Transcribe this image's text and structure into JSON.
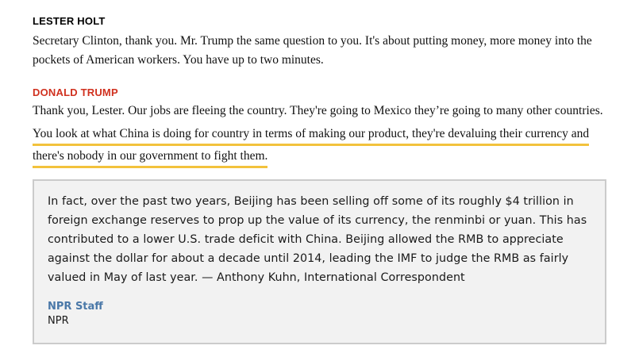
{
  "exchange": {
    "holt": {
      "speaker": "LESTER HOLT",
      "text": "Secretary Clinton, thank you. Mr. Trump the same question to you. It's about putting money, more money into the pockets of American workers. You have up to two minutes."
    },
    "trump": {
      "speaker": "DONALD TRUMP",
      "text_plain": "Thank you, Lester. Our jobs are fleeing the country. They're going to Mexico they’re going to many other countries.",
      "text_highlight_1": "You look at what China is doing for country in terms of making our product, they're devaluing their currency and",
      "text_highlight_2": "there's nobody in our government to fight them."
    }
  },
  "annotation": {
    "text": "In fact, over the past two years, Beijing has been selling off some of its roughly $4 trillion in foreign exchange reserves to prop up the value of its currency, the renminbi or yuan. This has contributed to a lower U.S. trade deficit with China. Beijing allowed the RMB to appreciate against the dollar for about a decade until 2014, leading the IMF to judge the RMB as fairly valued in May of last year. — Anthony Kuhn, International Correspondent",
    "author": "NPR Staff",
    "org": "NPR"
  },
  "colors": {
    "trump_name": "#d0311f",
    "highlight_underline": "#f2c23c",
    "author_link": "#4a78a8",
    "annotation_bg": "#f2f2f2",
    "annotation_border": "#cbcbcb"
  }
}
